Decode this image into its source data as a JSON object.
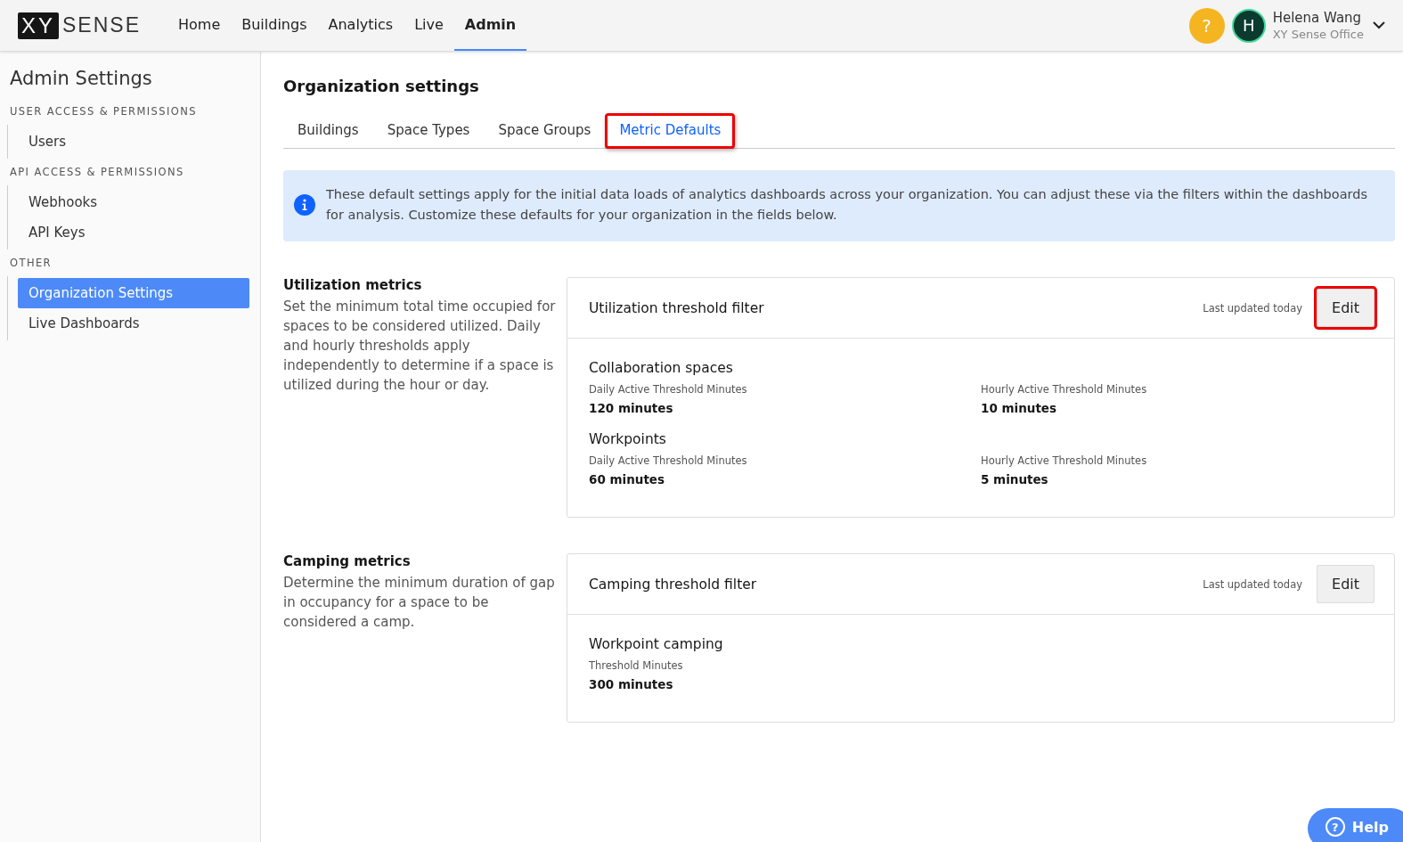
{
  "header": {
    "logo": {
      "mark": "XY",
      "word": "SENSE"
    },
    "nav": [
      {
        "label": "Home",
        "selected": false
      },
      {
        "label": "Buildings",
        "selected": false
      },
      {
        "label": "Analytics",
        "selected": false
      },
      {
        "label": "Live",
        "selected": false
      },
      {
        "label": "Admin",
        "selected": true
      }
    ],
    "help_icon": "?",
    "user": {
      "initial": "H",
      "name": "Helena Wang",
      "org": "XY Sense Office"
    }
  },
  "sidebar": {
    "title": "Admin Settings",
    "groups": [
      {
        "heading": "USER ACCESS & PERMISSIONS",
        "items": [
          {
            "label": "Users",
            "selected": false
          }
        ]
      },
      {
        "heading": "API ACCESS & PERMISSIONS",
        "items": [
          {
            "label": "Webhooks",
            "selected": false
          },
          {
            "label": "API Keys",
            "selected": false
          }
        ]
      },
      {
        "heading": "OTHER",
        "items": [
          {
            "label": "Organization Settings",
            "selected": true
          },
          {
            "label": "Live Dashboards",
            "selected": false
          }
        ]
      }
    ]
  },
  "page_title": "Organization settings",
  "tabs": [
    {
      "label": "Buildings",
      "selected": false,
      "highlighted": false
    },
    {
      "label": "Space Types",
      "selected": false,
      "highlighted": false
    },
    {
      "label": "Space Groups",
      "selected": false,
      "highlighted": false
    },
    {
      "label": "Metric Defaults",
      "selected": true,
      "highlighted": true
    }
  ],
  "info": "These default settings apply for the initial data loads of analytics dashboards across your organization. You can adjust these via the filters within the dashboards for analysis. Customize these defaults for your organization in the fields below.",
  "sections": [
    {
      "title": "Utilization metrics",
      "description": "Set the minimum total time occupied for spaces to be considered utilized. Daily and hourly thresholds apply independently to determine if a space is utilized during the hour or day.",
      "card": {
        "title": "Utilization threshold filter",
        "updated": "Last updated today",
        "button": "Edit",
        "highlighted": true,
        "groups": [
          {
            "title": "Collaboration spaces",
            "fields": [
              {
                "label": "Daily Active Threshold Minutes",
                "value": "120 minutes"
              },
              {
                "label": "Hourly Active Threshold Minutes",
                "value": "10 minutes"
              }
            ]
          },
          {
            "title": "Workpoints",
            "fields": [
              {
                "label": "Daily Active Threshold Minutes",
                "value": "60 minutes"
              },
              {
                "label": "Hourly Active Threshold Minutes",
                "value": "5 minutes"
              }
            ]
          }
        ]
      }
    },
    {
      "title": "Camping metrics",
      "description": "Determine the minimum duration of gap in occupancy for a space to be considered a camp.",
      "card": {
        "title": "Camping threshold filter",
        "updated": "Last updated today",
        "button": "Edit",
        "highlighted": false,
        "groups": [
          {
            "title": "Workpoint camping",
            "fields": [
              {
                "label": "Threshold Minutes",
                "value": "300 minutes"
              }
            ]
          }
        ]
      }
    }
  ],
  "help_button": {
    "icon": "?",
    "label": "Help"
  }
}
